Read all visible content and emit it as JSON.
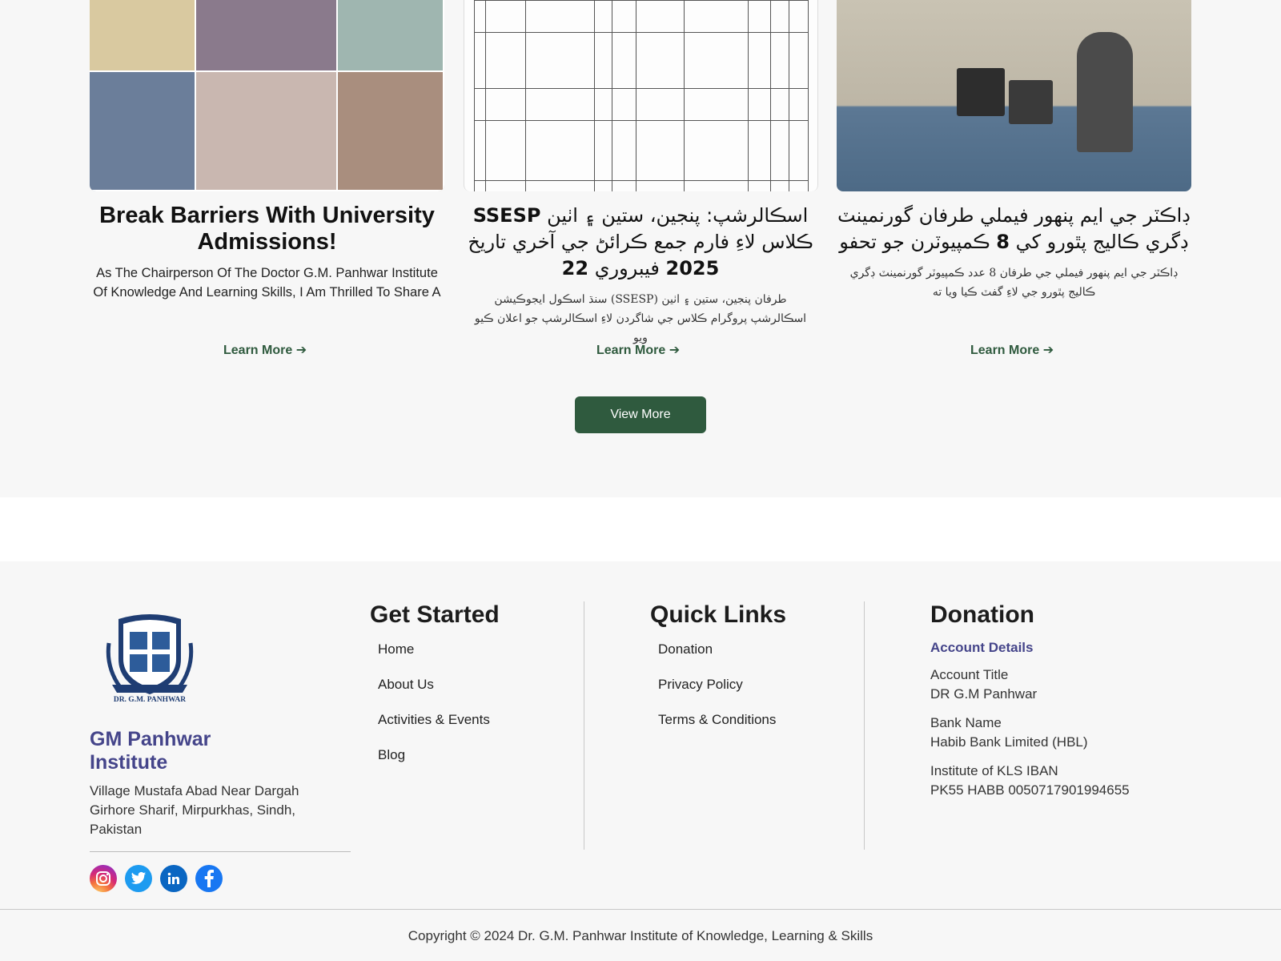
{
  "cards": [
    {
      "title": "Break Barriers With University Admissions!",
      "excerpt": "As The Chairperson Of The Doctor G.M. Panhwar Institute Of Knowledge And Learning Skills, I Am Thrilled To Share A",
      "link": "Learn More ➔"
    },
    {
      "title_line1": "اسڪالرشپ: پنجين، ستين ۽ اٺين",
      "title_bold1": "SSESP",
      "title_line2": "ڪلاس لاءِ فارم جمع ڪرائڻ جي آخري تاريخ",
      "title_line3a": "2025",
      "title_line3b": "22",
      "title_line3c": "فيبروري",
      "excerpt": "طرفان پنجين، ستين ۽ اٺين (SSESP) سنڌ اسڪول ايجوڪيشن اسڪالرشپ پروگرام ڪلاس جي شاگردن لاءِ اسڪالرشپ جو اعلان ڪيو ويو",
      "link": "Learn More ➔"
    },
    {
      "title_line1": "ڊاڪٽر جي ايم پنھور فيملي طرفان گورنمينٽ",
      "title_line2a": "ڊگري ڪاليج پٿورو کي",
      "title_bold": "8",
      "title_line2b": "ڪمپيوٽرن جو تحفو",
      "excerpt": "ڊاڪٽر جي ايم پنھور فيملي جي طرفان 8 عدد ڪمپيوٽر گورنمينٽ ڊگري ڪاليج پٿورو جي لاءِ گفٽ ڪيا ويا ته",
      "link": "Learn More ➔"
    }
  ],
  "view_more": "View More",
  "footer": {
    "logo_text": "DR. G.M. PANHWAR",
    "org_name": "GM Panhwar Institute",
    "address": "Village Mustafa Abad Near Dargah Girhore Sharif, Mirpurkhas, Sindh, Pakistan",
    "get_started": {
      "heading": "Get Started",
      "items": [
        "Home",
        "About Us",
        "Activities & Events",
        "Blog"
      ]
    },
    "quick_links": {
      "heading": "Quick Links",
      "items": [
        "Donation",
        "Privacy Policy",
        "Terms & Conditions"
      ]
    },
    "donation": {
      "heading": "Donation",
      "subheading": "Account Details",
      "rows": [
        {
          "label": "Account Title",
          "value": "DR G.M Panhwar"
        },
        {
          "label": "Bank Name",
          "value": "Habib Bank Limited (HBL)"
        },
        {
          "label": "Institute of KLS IBAN",
          "value": "PK55 HABB 0050717901994655"
        }
      ]
    },
    "socials": [
      "instagram-icon",
      "twitter-icon",
      "linkedin-icon",
      "facebook-icon"
    ],
    "copyright": "Copyright © 2024 Dr. G.M. Panhwar Institute of Knowledge, Learning & Skills"
  },
  "colors": {
    "accent_green": "#2f5a3e",
    "brand_purple": "#45458a"
  }
}
